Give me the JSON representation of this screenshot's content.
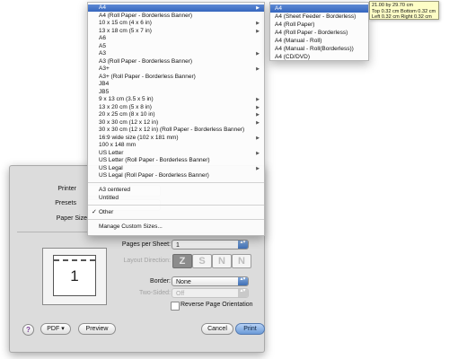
{
  "paper_menu": {
    "items": [
      {
        "label": "A4",
        "submenu": true,
        "highlighted": true
      },
      {
        "label": "A4 (Roll Paper - Borderless Banner)",
        "submenu": false
      },
      {
        "label": "10 x 15 cm (4 x 6 in)",
        "submenu": true
      },
      {
        "label": "13 x 18 cm (5 x 7 in)",
        "submenu": true
      },
      {
        "label": "A6",
        "submenu": false
      },
      {
        "label": "A5",
        "submenu": false
      },
      {
        "label": "A3",
        "submenu": true
      },
      {
        "label": "A3 (Roll Paper - Borderless Banner)",
        "submenu": false
      },
      {
        "label": "A3+",
        "submenu": true
      },
      {
        "label": "A3+ (Roll Paper - Borderless Banner)",
        "submenu": false
      },
      {
        "label": "JB4",
        "submenu": false
      },
      {
        "label": "JB5",
        "submenu": false
      },
      {
        "label": "9 x 13 cm (3.5 x 5 in)",
        "submenu": true
      },
      {
        "label": "13 x 20 cm (5 x 8 in)",
        "submenu": true
      },
      {
        "label": "20 x 25 cm (8 x 10 in)",
        "submenu": true
      },
      {
        "label": "30 x 30 cm (12 x 12 in)",
        "submenu": true
      },
      {
        "label": "30 x 30 cm (12 x 12 in) (Roll Paper - Borderless Banner)",
        "submenu": false
      },
      {
        "label": "16:9 wide size (102 x 181 mm)",
        "submenu": true
      },
      {
        "label": "100 x 148 mm",
        "submenu": false
      },
      {
        "label": "US Letter",
        "submenu": true
      },
      {
        "label": "US Letter (Roll Paper - Borderless Banner)",
        "submenu": false
      },
      {
        "label": "US Legal",
        "submenu": true
      },
      {
        "label": "US Legal (Roll Paper - Borderless Banner)",
        "submenu": false
      }
    ],
    "custom_items": [
      {
        "label": "A3 centered",
        "checked": false
      },
      {
        "label": "Untitled",
        "checked": false
      }
    ],
    "other_item": {
      "label": "Other",
      "checked": true
    },
    "manage_label": "Manage Custom Sizes..."
  },
  "submenu": {
    "items": [
      {
        "label": "A4",
        "highlighted": true
      },
      {
        "label": "A4 (Sheet Feeder - Borderless)",
        "highlighted": false
      },
      {
        "label": "A4 (Roll Paper)",
        "highlighted": false
      },
      {
        "label": "A4 (Roll Paper - Borderless)",
        "highlighted": false
      },
      {
        "label": "A4 (Manual - Roll)",
        "highlighted": false
      },
      {
        "label": "A4 (Manual - Roll(Borderless))",
        "highlighted": false
      },
      {
        "label": "A4 (CD/DVD)",
        "highlighted": false
      }
    ]
  },
  "tooltip": {
    "line1": "21.00 by 29.70 cm",
    "line2": "Top 0.32 cm Bottom 0.32 cm",
    "line3": "Left 0.32 cm Right 0.32 cm"
  },
  "dialog": {
    "printer_label": "Printer",
    "presets_label": "Presets",
    "paper_size_label": "Paper Size",
    "preview_page_number": "1",
    "pages_per_sheet_label": "Pages per Sheet:",
    "pages_per_sheet_value": "1",
    "layout_direction_label": "Layout Direction:",
    "border_label": "Border:",
    "border_value": "None",
    "two_sided_label": "Two-Sided:",
    "two_sided_value": "Off",
    "reverse_orientation_label": "Reverse Page Orientation",
    "reverse_orientation_checked": false,
    "help_glyph": "?",
    "pdf_label": "PDF ▾",
    "preview_label": "Preview",
    "cancel_label": "Cancel",
    "print_label": "Print"
  },
  "icons": {
    "submenu_arrow": "▶",
    "checkmark": "✓",
    "popup_arrows": "▴▾",
    "dir_glyphs": [
      "Z",
      "S",
      "N",
      "N"
    ]
  },
  "colors": {
    "highlight": "#3566be",
    "tooltip_bg": "#fdfdc6",
    "default_button": "#6b9ad7"
  }
}
